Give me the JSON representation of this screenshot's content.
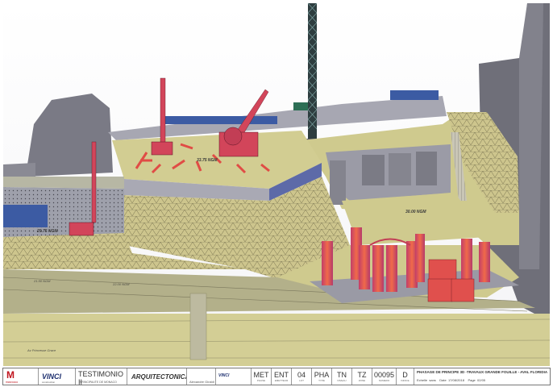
{
  "drawing": {
    "level_labels": {
      "platform_upper": "33.75 NGM",
      "platform_left": "29.75 NGM",
      "platform_right": "30.00 NGM",
      "lower_left": "21.50 NGM",
      "lower_mid": "22.00 NGM",
      "bottom": "Av Princesse Grace"
    }
  },
  "title_block": {
    "logo_letters": "M",
    "logo_sub": "marzocco",
    "vinci_label": "VINCI",
    "vinci_sub": "construction",
    "project_name": "TESTIMONIO II",
    "project_sub": "PRINCIPAUTE DE MONACO",
    "architect": "ARQUITECTONICA",
    "architect2": "Alexandre Giraldi",
    "vinci2_label": "VINCI",
    "codes": [
      {
        "value": "MET",
        "key": "PHASE"
      },
      {
        "value": "ENT",
        "key": "EMETTEUR"
      },
      {
        "value": "04",
        "key": "LOT"
      },
      {
        "value": "PHA",
        "key": "TYPE"
      },
      {
        "value": "TN",
        "key": "NIVEAU"
      },
      {
        "value": "TZ",
        "key": "ZONE"
      },
      {
        "value": "00095",
        "key": "NUMERO"
      },
      {
        "value": "D",
        "key": "INDICE"
      }
    ],
    "description": "PHASAGE DE PRINCIPE 3D -TRAVAUX GRANDE FOUILLE - AVAL FLORIDIA",
    "echelle_label": "Echelle",
    "echelle_value": "sans",
    "date_label": "Date",
    "date_value": "17/08/2018",
    "page_label": "Page",
    "page_value": "02/05"
  },
  "colors": {
    "ground": "#cfca8e",
    "wall": "#8d8d9a",
    "building": "#6f6f79",
    "equipment": "#d2455a",
    "blue_panel": "#3c5ba3",
    "silo": "#e0504d"
  }
}
